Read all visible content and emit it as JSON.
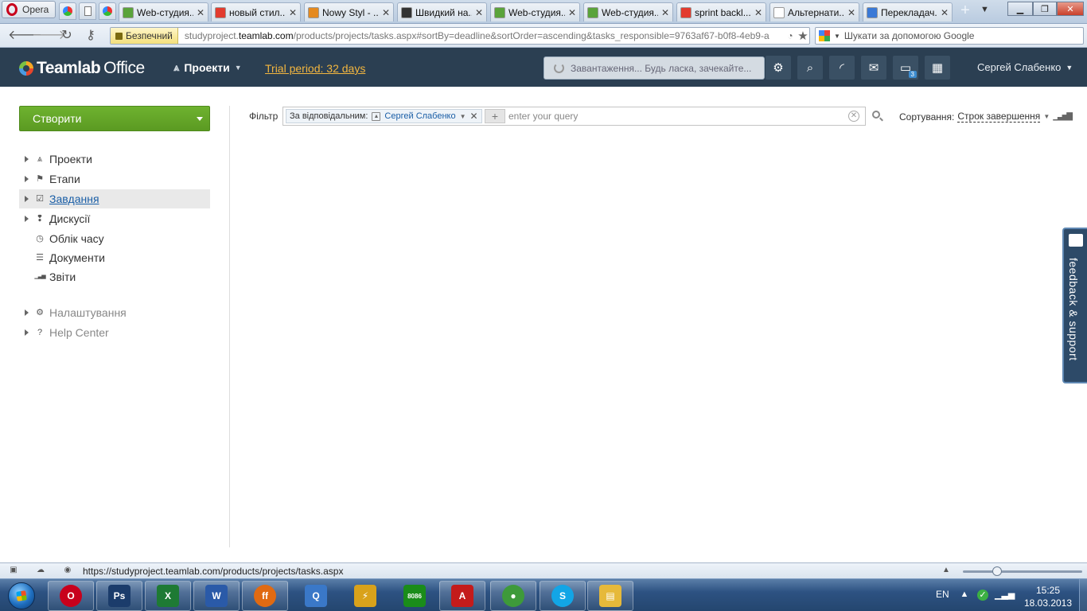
{
  "browser": {
    "menu_label": "Opera",
    "tabs": [
      {
        "title": "Web-студия...",
        "color": "#5aa33a"
      },
      {
        "title": "новый стил...",
        "color": "#e23b2e"
      },
      {
        "title": "Nowy Styl - ...",
        "color": "#e58a1f"
      },
      {
        "title": "Швидкий на...",
        "color": "#333333"
      },
      {
        "title": "Web-студия...",
        "color": "#5aa33a"
      },
      {
        "title": "Web-студия...",
        "color": "#5aa33a"
      },
      {
        "title": "sprint backl...",
        "color": "#e23b2e"
      },
      {
        "title": "Альтернати...",
        "color": "#ffffff"
      },
      {
        "title": "Перекладач...",
        "color": "#3a79d6"
      }
    ],
    "secure_label": "Безпечний",
    "url_prefix": "studyproject.",
    "url_domain": "teamlab.com",
    "url_path": "/products/projects/tasks.aspx#sortBy=deadline&sortOrder=ascending&tasks_responsible=9763af67-b0f8-4eb9-a",
    "search_placeholder": "Шукати за допомогою Google"
  },
  "header": {
    "logo_team": "Teamlab",
    "logo_office": "Office",
    "module_label": "Проекти",
    "trial_label": "Trial period: 32 days",
    "loading_text": "Завантаження... Будь ласка, зачекайте...",
    "messages_badge": "3",
    "user_name": "Сергей Слабенко"
  },
  "sidebar": {
    "create_label": "Створити",
    "items": [
      {
        "label": "Проекти",
        "icon": "projects-icon",
        "glyph": "⩓",
        "arrow": true
      },
      {
        "label": "Етапи",
        "icon": "flag-icon",
        "glyph": "⚑",
        "arrow": true
      },
      {
        "label": "Завдання",
        "icon": "checkbox-icon",
        "glyph": "☑",
        "arrow": true
      },
      {
        "label": "Дискусії",
        "icon": "discussion-icon",
        "glyph": "❢",
        "arrow": true
      },
      {
        "label": "Облік часу",
        "icon": "clock-icon",
        "glyph": "◷",
        "arrow": false
      },
      {
        "label": "Документи",
        "icon": "document-icon",
        "glyph": "☰",
        "arrow": false
      },
      {
        "label": "Звіти",
        "icon": "reports-icon",
        "glyph": "▁▃▅",
        "arrow": false
      },
      {
        "label": "Налаштування",
        "icon": "gear-icon",
        "glyph": "⚙",
        "arrow": true
      },
      {
        "label": "Help Center",
        "icon": "help-icon",
        "glyph": "?",
        "arrow": true
      }
    ]
  },
  "filter": {
    "label": "Фільтр",
    "chip_label": "За відповідальним:",
    "chip_value": "Сергей Слабенко",
    "query_placeholder": "enter your query",
    "sort_label": "Сортування:",
    "sort_value": "Строк завершення"
  },
  "feedback": {
    "label": "feedback & support"
  },
  "status": {
    "url": "https://studyproject.teamlab.com/products/projects/tasks.aspx"
  },
  "taskbar": {
    "apps": [
      {
        "name": "opera",
        "glyph": "O",
        "color": "#c8001c"
      },
      {
        "name": "photoshop",
        "glyph": "Ps",
        "color": "#1b3c6b"
      },
      {
        "name": "excel",
        "glyph": "X",
        "color": "#1e7a34"
      },
      {
        "name": "word",
        "glyph": "W",
        "color": "#2a5aa8"
      },
      {
        "name": "firefox",
        "glyph": "ff",
        "color": "#e06a12"
      },
      {
        "name": "qip",
        "glyph": "Q",
        "color": "#3a78c8"
      },
      {
        "name": "winamp",
        "glyph": "⚡",
        "color": "#d9a21b"
      },
      {
        "name": "emu8086",
        "glyph": "8086",
        "color": "#1a8c1a"
      },
      {
        "name": "acrobat",
        "glyph": "A",
        "color": "#c41b1b"
      },
      {
        "name": "chrome",
        "glyph": "●",
        "color": "#3e9a3a"
      },
      {
        "name": "skype",
        "glyph": "S",
        "color": "#12a5e6"
      },
      {
        "name": "explorer",
        "glyph": "▤",
        "color": "#e6b93a"
      }
    ],
    "lang": "EN",
    "time": "15:25",
    "date": "18.03.2013"
  }
}
